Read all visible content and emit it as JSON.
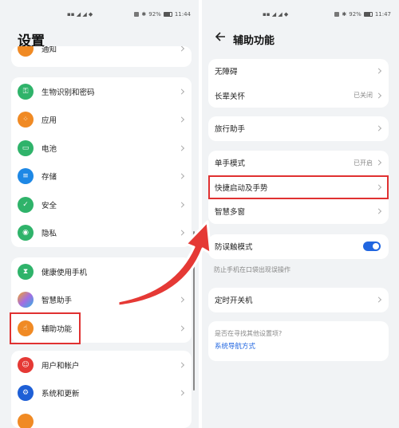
{
  "left": {
    "status_time": "11:44",
    "status_battery": "92%",
    "title": "设置",
    "partial_top_label": "通知",
    "group1": [
      {
        "label": "生物识别和密码",
        "icon": "key-icon",
        "color": "#2fb36a"
      },
      {
        "label": "应用",
        "icon": "apps-icon",
        "color": "#f08a24"
      },
      {
        "label": "电池",
        "icon": "battery-icon",
        "color": "#2fb36a"
      },
      {
        "label": "存储",
        "icon": "storage-icon",
        "color": "#1e88e5"
      },
      {
        "label": "安全",
        "icon": "shield-icon",
        "color": "#2fb36a"
      },
      {
        "label": "隐私",
        "icon": "privacy-icon",
        "color": "#2fb36a"
      }
    ],
    "group2": [
      {
        "label": "健康使用手机",
        "icon": "hourglass-icon",
        "color": "#2fb36a"
      },
      {
        "label": "智慧助手",
        "icon": "assistant-icon",
        "color": "#a56de2"
      },
      {
        "label": "辅助功能",
        "icon": "hand-icon",
        "color": "#f08a24"
      }
    ],
    "group3": [
      {
        "label": "用户和帐户",
        "icon": "user-icon",
        "color": "#e53935"
      },
      {
        "label": "系统和更新",
        "icon": "gear-icon",
        "color": "#1e5fd6"
      },
      {
        "label": "",
        "icon": "partial-icon",
        "color": "#f08a24"
      }
    ]
  },
  "right": {
    "status_time": "11:47",
    "status_battery": "92%",
    "title": "辅助功能",
    "group1": [
      {
        "label": "无障碍",
        "value": ""
      },
      {
        "label": "长辈关怀",
        "value": "已关闭"
      }
    ],
    "group2": [
      {
        "label": "旅行助手",
        "value": ""
      }
    ],
    "group3": [
      {
        "label": "单手模式",
        "value": "已开启"
      },
      {
        "label": "快捷启动及手势",
        "value": ""
      },
      {
        "label": "智慧多窗",
        "value": ""
      }
    ],
    "toggle_label": "防误触模式",
    "toggle_on": true,
    "toggle_desc": "防止手机在口袋出现误操作",
    "timer_label": "定时开关机",
    "help_question": "是否在寻找其他设置项?",
    "help_link": "系统导航方式"
  },
  "colors": {
    "highlight": "#e03131",
    "accent": "#2166e0"
  }
}
